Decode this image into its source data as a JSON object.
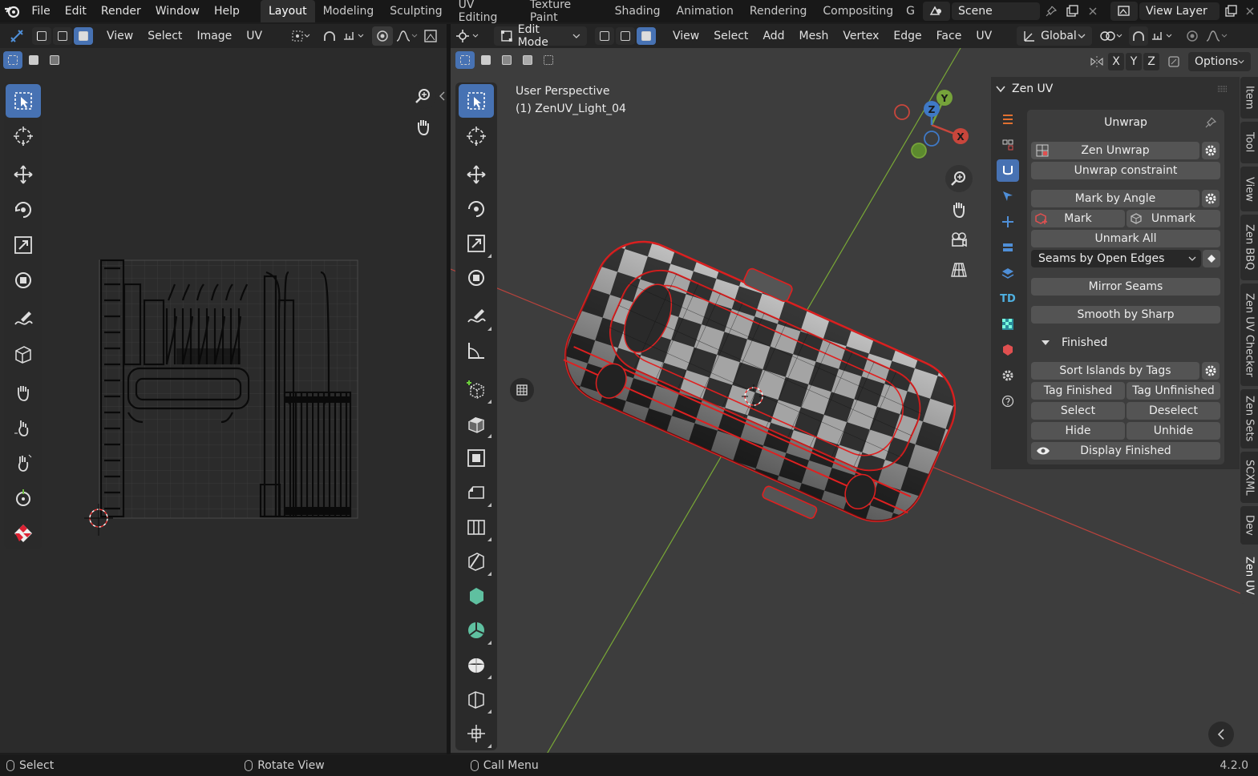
{
  "topbar": {
    "menus": [
      "File",
      "Edit",
      "Render",
      "Window",
      "Help"
    ],
    "workspaces": [
      "Layout",
      "Modeling",
      "Sculpting",
      "UV Editing",
      "Texture Paint",
      "Shading",
      "Animation",
      "Rendering",
      "Compositing",
      "G"
    ],
    "active_workspace": "Layout",
    "scene": "Scene",
    "view_layer": "View Layer"
  },
  "uv_editor": {
    "menus": [
      "View",
      "Select",
      "Image",
      "UV"
    ]
  },
  "viewport": {
    "mode": "Edit Mode",
    "menus": [
      "View",
      "Select",
      "Add",
      "Mesh",
      "Vertex",
      "Edge",
      "Face",
      "UV"
    ],
    "orientation": "Global",
    "axes": [
      "X",
      "Y",
      "Z"
    ],
    "options_label": "Options",
    "overlay_line1": "User Perspective",
    "overlay_line2": "(1) ZenUV_Light_04",
    "gizmo": {
      "x": "X",
      "y": "Y",
      "z": "Z"
    }
  },
  "zen_panel": {
    "title": "Zen UV",
    "section": "Unwrap",
    "zen_unwrap": "Zen Unwrap",
    "unwrap_constraint": "Unwrap constraint",
    "mark_by_angle": "Mark by Angle",
    "mark": "Mark",
    "unmark": "Unmark",
    "unmark_all": "Unmark All",
    "seams_dropdown": "Seams by Open Edges",
    "mirror_seams": "Mirror Seams",
    "smooth_by_sharp": "Smooth by Sharp",
    "finished_header": "Finished",
    "sort_islands": "Sort Islands by Tags",
    "tag_finished": "Tag Finished",
    "tag_unfinished": "Tag Unfinished",
    "select": "Select",
    "deselect": "Deselect",
    "hide": "Hide",
    "unhide": "Unhide",
    "display_finished": "Display Finished",
    "td_label": "TD"
  },
  "side_tabs": [
    "Item",
    "Tool",
    "View",
    "Zen BBQ",
    "Zen UV Checker",
    "Zen Sets",
    "SCXML",
    "Dev",
    "Zen UV"
  ],
  "active_side_tab": "Zen UV",
  "statusbar": {
    "select": "Select",
    "rotate": "Rotate View",
    "call_menu": "Call Menu",
    "version": "4.2.0"
  },
  "colors": {
    "accent": "#4772b3",
    "seam": "#e02020",
    "x_axis": "#c8463c",
    "y_axis": "#76a33a"
  }
}
